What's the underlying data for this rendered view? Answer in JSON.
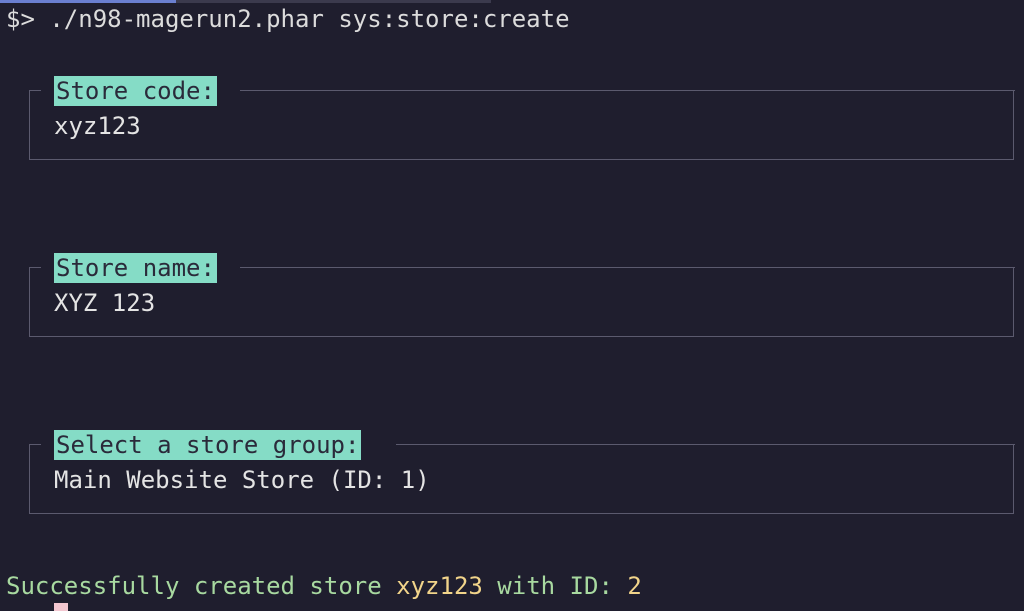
{
  "terminal": {
    "prompt_symbol": "$>",
    "command": "./n98-magerun2.phar sys:store:create"
  },
  "fields": [
    {
      "label": "Store code:",
      "value": "xyz123"
    },
    {
      "label": "Store name:",
      "value": "XYZ 123"
    },
    {
      "label": "Select a store group:",
      "value": "Main Website Store (ID: 1)"
    }
  ],
  "result": {
    "prefix": "Successfully created store ",
    "store_code": "xyz123",
    "middle": " with ID: ",
    "store_id": "2"
  },
  "colors": {
    "background": "#1f1e2e",
    "label_highlight": "#85dcc6",
    "success_text": "#a8d9a0",
    "success_highlight": "#f1d48a",
    "cursor": "#f3c7d0"
  }
}
